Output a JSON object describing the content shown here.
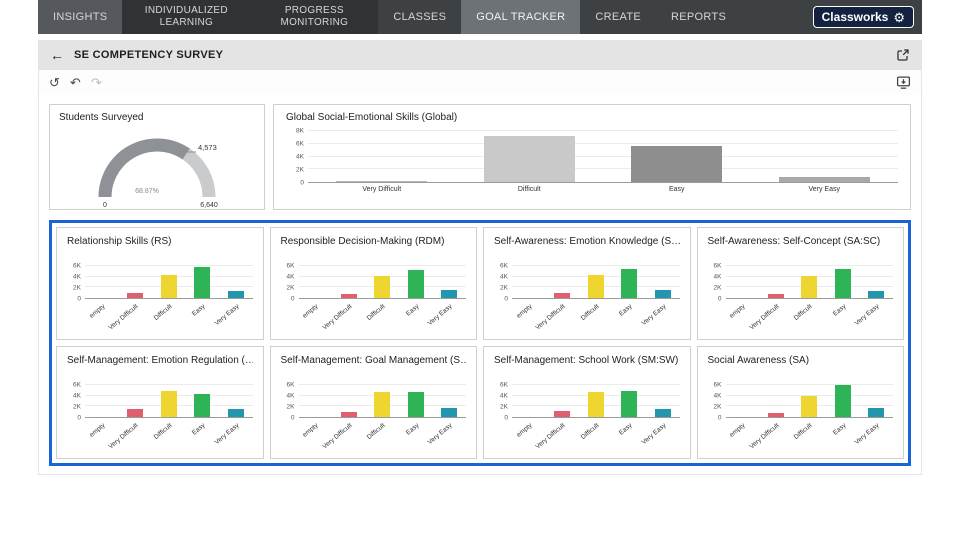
{
  "nav": {
    "brand": "Classworks",
    "gear_glyph": "⚙",
    "items": [
      {
        "label": "INSIGHTS"
      },
      {
        "label": "INDIVIDUALIZED LEARNING"
      },
      {
        "label": "PROGRESS MONITORING"
      },
      {
        "label": "CLASSES"
      },
      {
        "label": "GOAL TRACKER"
      },
      {
        "label": "CREATE"
      },
      {
        "label": "REPORTS"
      }
    ]
  },
  "header": {
    "back_glyph": "←",
    "title": "SE COMPETENCY SURVEY"
  },
  "toolbar": {
    "reset_glyph": "↺",
    "undo_glyph": "↶",
    "redo_glyph": "↷"
  },
  "gauge_card": {
    "title": "Students Surveyed",
    "value_label": "4,573",
    "min_label": "0",
    "max_label": "6,640",
    "percent_label": "68.87%",
    "fraction": 0.6887
  },
  "global_card": {
    "title": "Global Social-Emotional Skills (Global)",
    "chart": {
      "type": "bar",
      "ymax": 8000,
      "yticks": [
        {
          "label": "8K",
          "value": 8000
        },
        {
          "label": "6K",
          "value": 6000
        },
        {
          "label": "4K",
          "value": 4000
        },
        {
          "label": "2K",
          "value": 2000
        },
        {
          "label": "0",
          "value": 0
        }
      ],
      "categories": [
        "Very Difficult",
        "Difficult",
        "Easy",
        "Very Easy"
      ],
      "values": [
        150,
        7200,
        5700,
        750
      ],
      "colors": [
        "#b8b8b8",
        "#c9c9c9",
        "#8e8e8e",
        "#a9a9a9"
      ],
      "rotate": false
    }
  },
  "cards": [
    {
      "title": "Relationship Skills (RS)",
      "chart": {
        "type": "bar",
        "ymax": 7000,
        "yticks": [
          {
            "label": "6K",
            "value": 6000
          },
          {
            "label": "4K",
            "value": 4000
          },
          {
            "label": "2K",
            "value": 2000
          },
          {
            "label": "0",
            "value": 0
          }
        ],
        "categories": [
          "empty",
          "Very Difficult",
          "Difficult",
          "Easy",
          "Very Easy"
        ],
        "values": [
          0,
          900,
          4300,
          5800,
          1300
        ],
        "colors": [
          "#cccccc",
          "#df5f6d",
          "#eed52f",
          "#2eb457",
          "#2196ad"
        ],
        "rotate": true
      }
    },
    {
      "title": "Responsible Decision-Making (RDM)",
      "chart": {
        "type": "bar",
        "ymax": 7000,
        "yticks": [
          {
            "label": "6K",
            "value": 6000
          },
          {
            "label": "4K",
            "value": 4000
          },
          {
            "label": "2K",
            "value": 2000
          },
          {
            "label": "0",
            "value": 0
          }
        ],
        "categories": [
          "empty",
          "Very Difficult",
          "Difficult",
          "Easy",
          "Very Easy"
        ],
        "values": [
          0,
          850,
          4100,
          5300,
          1500
        ],
        "colors": [
          "#cccccc",
          "#df5f6d",
          "#eed52f",
          "#2eb457",
          "#2196ad"
        ],
        "rotate": true
      }
    },
    {
      "title": "Self-Awareness: Emotion Knowledge (S…",
      "chart": {
        "type": "bar",
        "ymax": 7000,
        "yticks": [
          {
            "label": "6K",
            "value": 6000
          },
          {
            "label": "4K",
            "value": 4000
          },
          {
            "label": "2K",
            "value": 2000
          },
          {
            "label": "0",
            "value": 0
          }
        ],
        "categories": [
          "empty",
          "Very Difficult",
          "Difficult",
          "Easy",
          "Very Easy"
        ],
        "values": [
          0,
          950,
          4400,
          5500,
          1500
        ],
        "colors": [
          "#cccccc",
          "#df5f6d",
          "#eed52f",
          "#2eb457",
          "#2196ad"
        ],
        "rotate": true
      }
    },
    {
      "title": "Self-Awareness: Self-Concept (SA:SC)",
      "chart": {
        "type": "bar",
        "ymax": 7000,
        "yticks": [
          {
            "label": "6K",
            "value": 6000
          },
          {
            "label": "4K",
            "value": 4000
          },
          {
            "label": "2K",
            "value": 2000
          },
          {
            "label": "0",
            "value": 0
          }
        ],
        "categories": [
          "empty",
          "Very Difficult",
          "Difficult",
          "Easy",
          "Very Easy"
        ],
        "values": [
          0,
          800,
          4200,
          5400,
          1400
        ],
        "colors": [
          "#cccccc",
          "#df5f6d",
          "#eed52f",
          "#2eb457",
          "#2196ad"
        ],
        "rotate": true
      }
    },
    {
      "title": "Self-Management: Emotion Regulation (…",
      "chart": {
        "type": "bar",
        "ymax": 7000,
        "yticks": [
          {
            "label": "6K",
            "value": 6000
          },
          {
            "label": "4K",
            "value": 4000
          },
          {
            "label": "2K",
            "value": 2000
          },
          {
            "label": "0",
            "value": 0
          }
        ],
        "categories": [
          "empty",
          "Very Difficult",
          "Difficult",
          "Easy",
          "Very Easy"
        ],
        "values": [
          0,
          1500,
          5000,
          4400,
          1500
        ],
        "colors": [
          "#cccccc",
          "#df5f6d",
          "#eed52f",
          "#2eb457",
          "#2196ad"
        ],
        "rotate": true
      }
    },
    {
      "title": "Self-Management: Goal Management (S…",
      "chart": {
        "type": "bar",
        "ymax": 7000,
        "yticks": [
          {
            "label": "6K",
            "value": 6000
          },
          {
            "label": "4K",
            "value": 4000
          },
          {
            "label": "2K",
            "value": 2000
          },
          {
            "label": "0",
            "value": 0
          }
        ],
        "categories": [
          "empty",
          "Very Difficult",
          "Difficult",
          "Easy",
          "Very Easy"
        ],
        "values": [
          0,
          1000,
          4700,
          4800,
          1700
        ],
        "colors": [
          "#cccccc",
          "#df5f6d",
          "#eed52f",
          "#2eb457",
          "#2196ad"
        ],
        "rotate": true
      }
    },
    {
      "title": "Self-Management: School Work (SM:SW)",
      "chart": {
        "type": "bar",
        "ymax": 7000,
        "yticks": [
          {
            "label": "6K",
            "value": 6000
          },
          {
            "label": "4K",
            "value": 4000
          },
          {
            "label": "2K",
            "value": 2000
          },
          {
            "label": "0",
            "value": 0
          }
        ],
        "categories": [
          "empty",
          "Very Difficult",
          "Difficult",
          "Easy",
          "Very Easy"
        ],
        "values": [
          0,
          1200,
          4800,
          5000,
          1500
        ],
        "colors": [
          "#cccccc",
          "#df5f6d",
          "#eed52f",
          "#2eb457",
          "#2196ad"
        ],
        "rotate": true
      }
    },
    {
      "title": "Social Awareness (SA)",
      "chart": {
        "type": "bar",
        "ymax": 7000,
        "yticks": [
          {
            "label": "6K",
            "value": 6000
          },
          {
            "label": "4K",
            "value": 4000
          },
          {
            "label": "2K",
            "value": 2000
          },
          {
            "label": "0",
            "value": 0
          }
        ],
        "categories": [
          "empty",
          "Very Difficult",
          "Difficult",
          "Easy",
          "Very Easy"
        ],
        "values": [
          0,
          700,
          4000,
          6000,
          1700
        ],
        "colors": [
          "#cccccc",
          "#df5f6d",
          "#eed52f",
          "#2eb457",
          "#2196ad"
        ],
        "rotate": true
      }
    }
  ]
}
